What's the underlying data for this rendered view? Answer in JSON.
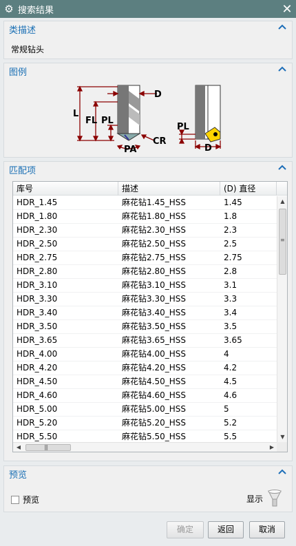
{
  "window": {
    "title": "搜索结果"
  },
  "class_description": {
    "header": "类描述",
    "value": "常规钻头"
  },
  "legend": {
    "header": "图例",
    "labels": {
      "D": "D",
      "L": "L",
      "FL": "FL",
      "PL": "PL",
      "CR": "CR",
      "PA": "PA",
      "PL2": "PL",
      "D2": "D"
    }
  },
  "matches": {
    "header": "匹配项",
    "columns": [
      "库号",
      "描述",
      "(D) 直径"
    ],
    "rows": [
      [
        "HDR_1.45",
        "麻花钻1.45_HSS",
        "1.45"
      ],
      [
        "HDR_1.80",
        "麻花钻1.80_HSS",
        "1.8"
      ],
      [
        "HDR_2.30",
        "麻花钻2.30_HSS",
        "2.3"
      ],
      [
        "HDR_2.50",
        "麻花钻2.50_HSS",
        "2.5"
      ],
      [
        "HDR_2.75",
        "麻花钻2.75_HSS",
        "2.75"
      ],
      [
        "HDR_2.80",
        "麻花钻2.80_HSS",
        "2.8"
      ],
      [
        "HDR_3.10",
        "麻花钻3.10_HSS",
        "3.1"
      ],
      [
        "HDR_3.30",
        "麻花钻3.30_HSS",
        "3.3"
      ],
      [
        "HDR_3.40",
        "麻花钻3.40_HSS",
        "3.4"
      ],
      [
        "HDR_3.50",
        "麻花钻3.50_HSS",
        "3.5"
      ],
      [
        "HDR_3.65",
        "麻花钻3.65_HSS",
        "3.65"
      ],
      [
        "HDR_4.00",
        "麻花钻4.00_HSS",
        "4"
      ],
      [
        "HDR_4.20",
        "麻花钻4.20_HSS",
        "4.2"
      ],
      [
        "HDR_4.50",
        "麻花钻4.50_HSS",
        "4.5"
      ],
      [
        "HDR_4.60",
        "麻花钻4.60_HSS",
        "4.6"
      ],
      [
        "HDR_5.00",
        "麻花钻5.00_HSS",
        "5"
      ],
      [
        "HDR_5.20",
        "麻花钻5.20_HSS",
        "5.2"
      ],
      [
        "HDR_5.50",
        "麻花钻5.50_HSS",
        "5.5"
      ]
    ]
  },
  "preview": {
    "header": "预览",
    "checkbox_label": "预览",
    "show_label": "显示"
  },
  "buttons": {
    "ok": "确定",
    "back": "返回",
    "cancel": "取消"
  },
  "icons": {
    "gear": "gear-icon",
    "close": "close-icon",
    "collapse": "chevron-up-icon",
    "show": "flashlight-icon"
  },
  "colors": {
    "titlebar": "#5c7f80",
    "section_header": "#1a6fb4",
    "dimension": "#8b0000",
    "insert": "#ffd400"
  }
}
